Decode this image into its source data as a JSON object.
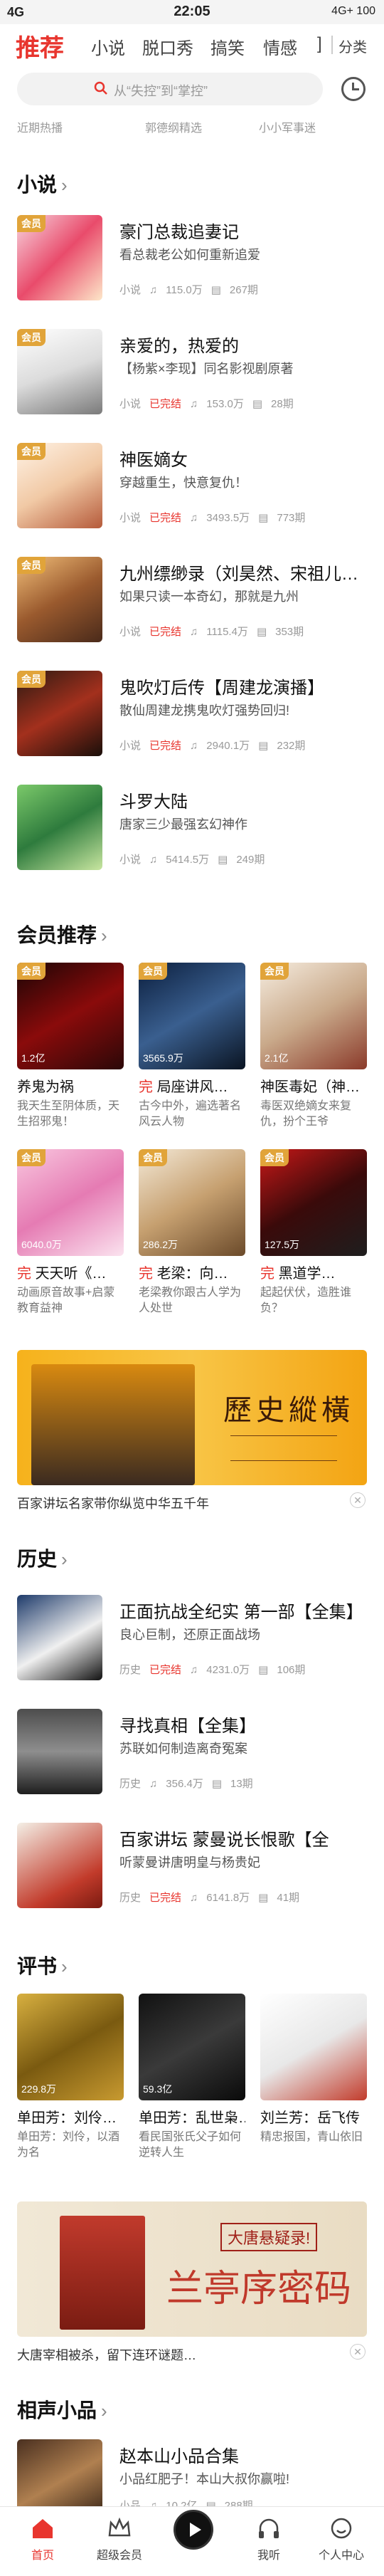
{
  "status": {
    "left": "4G",
    "time": "22:05",
    "right": "4G+ 100"
  },
  "nav": {
    "tabs": [
      "推荐",
      "小说",
      "脱口秀",
      "搞笑",
      "情感",
      "]"
    ],
    "category": "分类"
  },
  "search": {
    "placeholder": "从“失控”到“掌控”"
  },
  "rec_row": [
    "近期热播",
    "郭德纲精选",
    "小小军事迷"
  ],
  "novel": {
    "title": "小说",
    "items": [
      {
        "title": "豪门总裁追妻记",
        "desc": "看总裁老公如何重新追爱",
        "tag": "小说",
        "status": "",
        "plays": "115.0万",
        "eps": "267期"
      },
      {
        "title": "亲爱的，热爱的",
        "desc": "【杨紫×李现】同名影视剧原著",
        "tag": "小说",
        "status": "已完结",
        "plays": "153.0万",
        "eps": "28期"
      },
      {
        "title": "神医嫡女",
        "desc": "穿越重生，快意复仇！",
        "tag": "小说",
        "status": "已完结",
        "plays": "3493.5万",
        "eps": "773期"
      },
      {
        "title": "九州缥缈录（刘昊然、宋祖儿…",
        "desc": "如果只读一本奇幻，那就是九州",
        "tag": "小说",
        "status": "已完结",
        "plays": "1115.4万",
        "eps": "353期"
      },
      {
        "title": "鬼吹灯后传【周建龙演播】",
        "desc": "散仙周建龙携鬼吹灯强势回归!",
        "tag": "小说",
        "status": "已完结",
        "plays": "2940.1万",
        "eps": "232期"
      },
      {
        "title": "斗罗大陆",
        "desc": "唐家三少最强玄幻神作",
        "tag": "小说",
        "status": "",
        "plays": "5414.5万",
        "eps": "249期"
      }
    ]
  },
  "member": {
    "title": "会员推荐",
    "items": [
      {
        "title": "养鬼为祸",
        "prefix": "",
        "plays": "1.2亿",
        "desc": "我天生至阴体质，天生招邪鬼！"
      },
      {
        "title": "局座讲风…",
        "prefix": "完",
        "plays": "3565.9万",
        "desc": "古今中外，遍选著名风云人物"
      },
      {
        "title": "神医毒妃（神…",
        "prefix": "",
        "plays": "2.1亿",
        "desc": "毒医双绝嫡女来复仇，扮个王爷"
      },
      {
        "title": "天天听《…",
        "prefix": "完",
        "plays": "6040.0万",
        "desc": "动画原音故事+启蒙教育益神"
      },
      {
        "title": "老梁：向…",
        "prefix": "完",
        "plays": "286.2万",
        "desc": "老梁教你跟古人学为人处世"
      },
      {
        "title": "黑道学…",
        "prefix": "完",
        "plays": "127.5万",
        "desc": "起起伏伏，造胜谁负？"
      }
    ]
  },
  "banner1": {
    "caption": "百家讲坛名家带你纵览中华五千年",
    "art_text": "歷史縱橫"
  },
  "history": {
    "title": "历史",
    "items": [
      {
        "title": "正面抗战全纪实 第一部【全集】",
        "desc": "良心巨制，还原正面战场",
        "tag": "历史",
        "status": "已完结",
        "plays": "4231.0万",
        "eps": "106期"
      },
      {
        "title": "寻找真相【全集】",
        "desc": "苏联如何制造离奇冤案",
        "tag": "历史",
        "status": "",
        "plays": "356.4万",
        "eps": "13期"
      },
      {
        "title": "百家讲坛 蒙曼说长恨歌【全",
        "desc": "听蒙曼讲唐明皇与杨贵妃",
        "tag": "历史",
        "status": "已完结",
        "plays": "6141.8万",
        "eps": "41期"
      }
    ]
  },
  "pingshu": {
    "title": "评书",
    "items": [
      {
        "title": "单田芳：刘伶…",
        "prefix": "",
        "plays": "229.8万",
        "desc": "单田芳：刘伶，以酒为名"
      },
      {
        "title": "单田芳：乱世枭…",
        "prefix": "",
        "plays": "59.3亿",
        "desc": "看民国张氏父子如何逆转人生"
      },
      {
        "title": "刘兰芳：岳飞传",
        "prefix": "",
        "plays": "",
        "desc": "精忠报国，青山依旧"
      }
    ]
  },
  "banner2": {
    "caption": "大唐宰相被杀，留下连环谜题…",
    "art_text": "兰亭序密码",
    "art_sub": "大唐悬疑录!"
  },
  "crosstalk": {
    "title": "相声小品",
    "items": [
      {
        "title": "赵本山小品合集",
        "desc": "小品红肥子！本山大叔你赢啦!",
        "tag": "小品",
        "status": "",
        "plays": "10.2亿",
        "eps": "288期"
      }
    ]
  },
  "tabbar": [
    "首页",
    "超级会员",
    "",
    "我听",
    "个人中心"
  ],
  "colors": {
    "accent": "#e8352e",
    "vip": "#e1a43a"
  }
}
